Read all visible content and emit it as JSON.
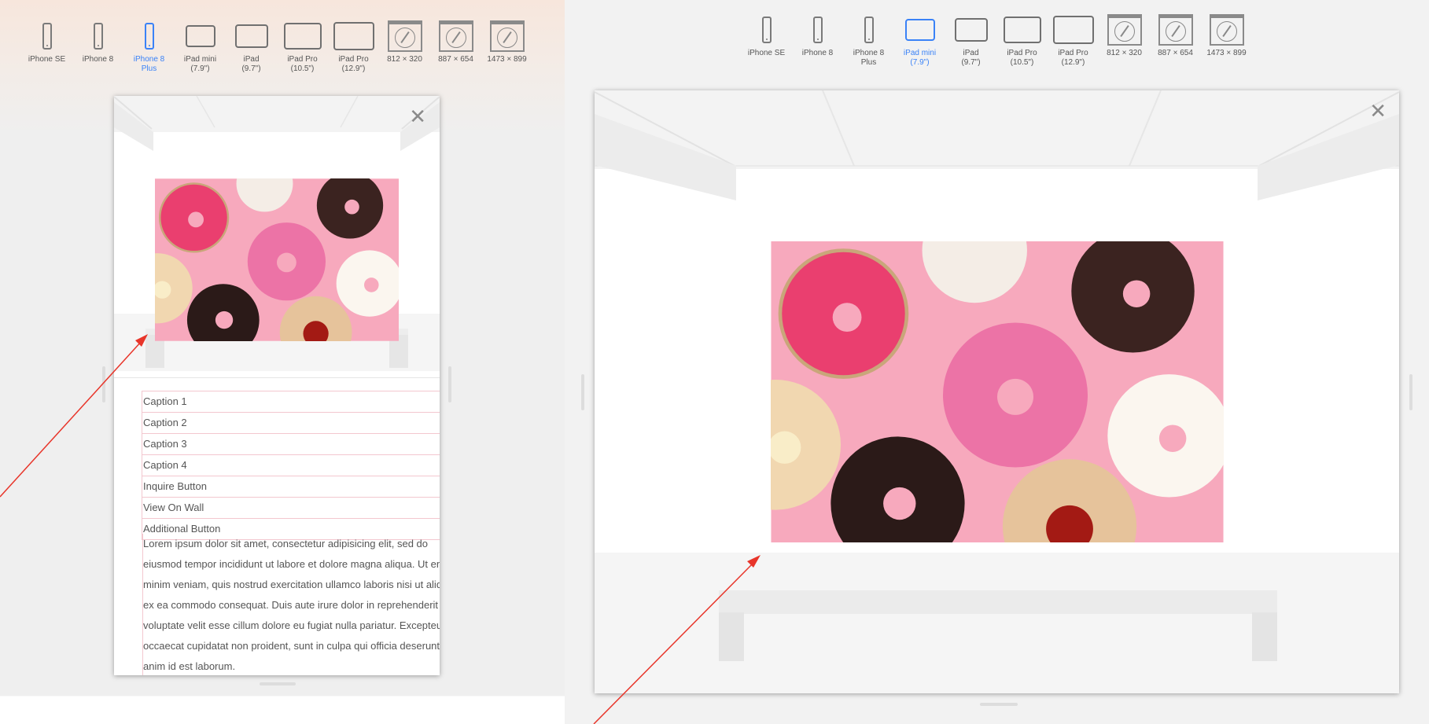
{
  "devices": [
    {
      "label": "iPhone SE",
      "icon": "phone-icon"
    },
    {
      "label": "iPhone 8",
      "icon": "phone-icon"
    },
    {
      "label": "iPhone 8\nPlus",
      "icon": "phone-icon"
    },
    {
      "label": "iPad mini\n(7.9\")",
      "icon": "tablet-icon"
    },
    {
      "label": "iPad\n(9.7\")",
      "icon": "tablet-icon"
    },
    {
      "label": "iPad Pro\n(10.5\")",
      "icon": "tablet-icon"
    },
    {
      "label": "iPad Pro\n(12.9\")",
      "icon": "tablet-icon"
    },
    {
      "label": "812 × 320",
      "icon": "browser-icon"
    },
    {
      "label": "887 × 654",
      "icon": "browser-icon"
    },
    {
      "label": "1473 × 899",
      "icon": "browser-icon"
    }
  ],
  "left_view": {
    "active_device": "iPhone 8 Plus",
    "close_icon": "✕",
    "captions": [
      "Caption 1",
      "Caption 2",
      "Caption 3",
      "Caption 4",
      "Inquire Button",
      "View On Wall",
      "Additional Button"
    ],
    "description": [
      "Lorem ipsum dolor sit amet, consectetur adipisicing elit, sed do",
      "eiusmod tempor incididunt ut labore et dolore magna aliqua. Ut enim ad",
      "minim veniam, quis nostrud exercitation ullamco laboris nisi ut aliquip",
      "ex ea commodo consequat. Duis aute irure dolor in reprehenderit in",
      "voluptate velit esse cillum dolore eu fugiat nulla pariatur. Excepteur sint",
      "occaecat cupidatat non proident, sunt in culpa qui officia deserunt mollit",
      "anim id est laborum."
    ]
  },
  "right_view": {
    "active_device": "iPad mini (7.9\")",
    "close_icon": "✕"
  },
  "colors": {
    "accent": "#3a82f7",
    "annotation_arrow": "#e8352a",
    "artwork_background": "#f7a9bd"
  }
}
